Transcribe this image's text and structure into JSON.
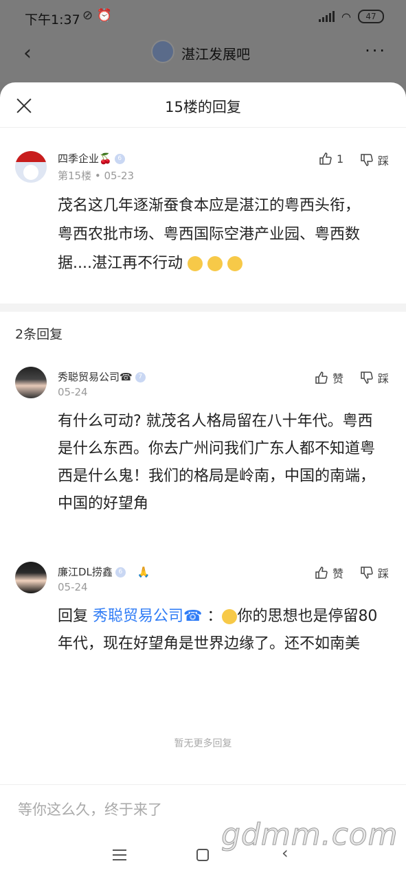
{
  "status_bar": {
    "time": "下午1:37",
    "battery": "47"
  },
  "top_header": {
    "forum_title": "湛江发展吧"
  },
  "sheet": {
    "title": "15楼的回复"
  },
  "main_post": {
    "username": "四季企业🍒",
    "level": "6",
    "floor": "第15楼",
    "date": "05-23",
    "like_count": "1",
    "dislike_label": "踩",
    "content": "茂名这几年逐渐蚕食本应是湛江的粤西头衔，粤西农批市场、粤西国际空港产业园、粤西数据....湛江再不行动"
  },
  "reply_count": "2条回复",
  "replies": [
    {
      "username": "秀聪贸易公司☎",
      "level": "7",
      "date": "05-24",
      "like_label": "赞",
      "dislike_label": "踩",
      "content": "有什么可动? 就茂名人格局留在八十年代。粤西是什么东西。你去广州问我们广东人都不知道粤西是什么鬼！我们的格局是岭南，中国的南端，中国的好望角"
    },
    {
      "username": "廉江DL捞鑫",
      "level": "6",
      "date": "05-24",
      "like_label": "赞",
      "dislike_label": "踩",
      "reply_prefix": "回复",
      "reply_to": "秀聪贸易公司☎",
      "colon": "：",
      "content": "你的思想也是停留80年代，现在好望角是世界边缘了。还不如南美"
    }
  ],
  "no_more": "暂无更多回复",
  "input": {
    "placeholder": "等你这么久，终于来了"
  },
  "watermark": "gdmm.com"
}
